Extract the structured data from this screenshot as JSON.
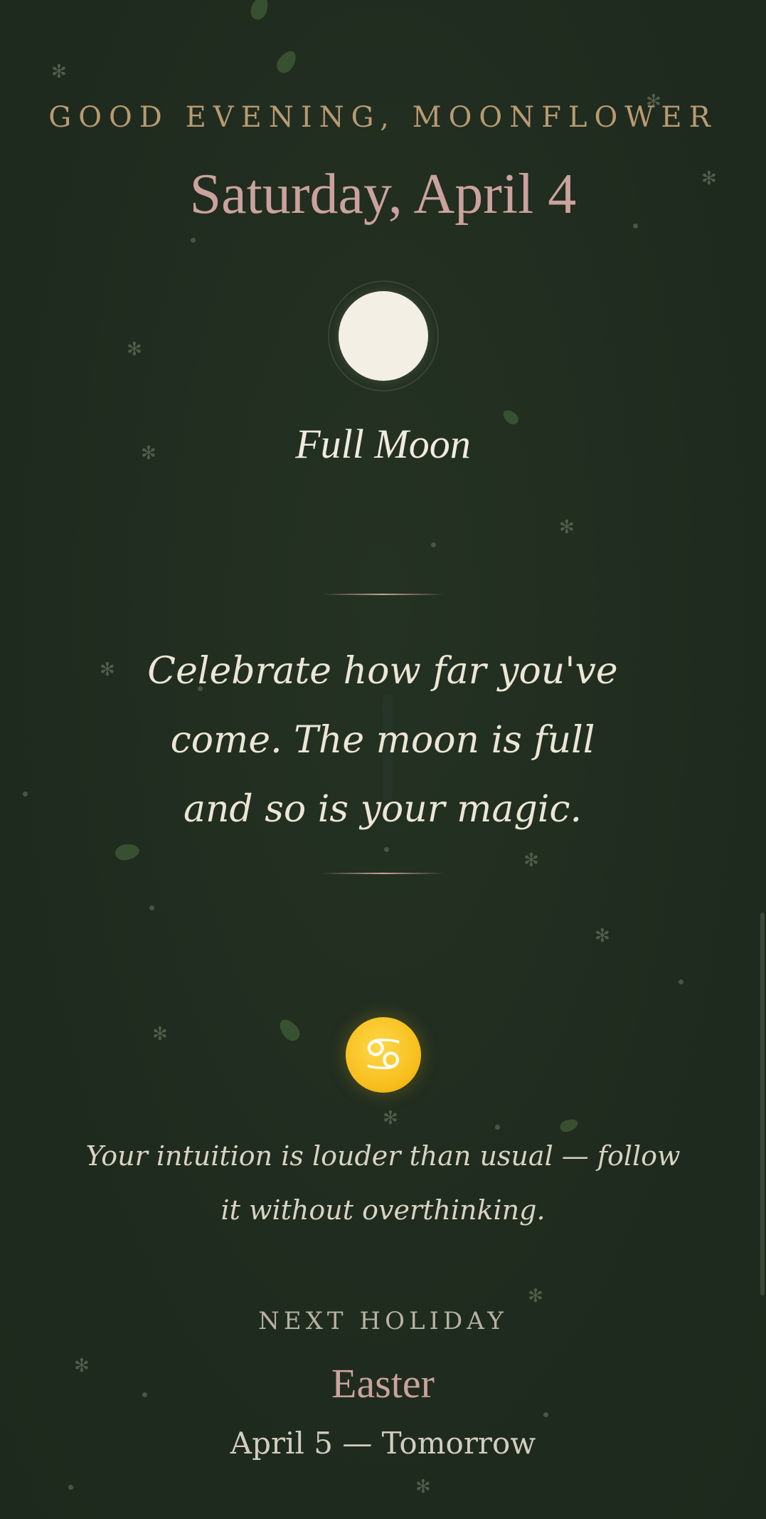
{
  "greeting": "GOOD EVENING, MOONFLOWER",
  "date": "Saturday, April 4",
  "moon": {
    "phase": "Full Moon",
    "icon": "full-moon-icon"
  },
  "affirmation": "Celebrate how far you've come. The moon is full and so is your magic.",
  "zodiac": {
    "icon": "cancer-zodiac-icon",
    "glyph": "♋",
    "horoscope": "Your intuition is louder than usual — follow it without overthinking."
  },
  "next_holiday": {
    "label": "NEXT HOLIDAY",
    "name": "Easter",
    "when": "April 5 — Tomorrow"
  },
  "colors": {
    "background": "#1f2b1e",
    "accent_rose": "#cba29d",
    "accent_gold": "#b99a72",
    "moon": "#f3efe4",
    "zodiac_badge": "#f7be1c"
  }
}
